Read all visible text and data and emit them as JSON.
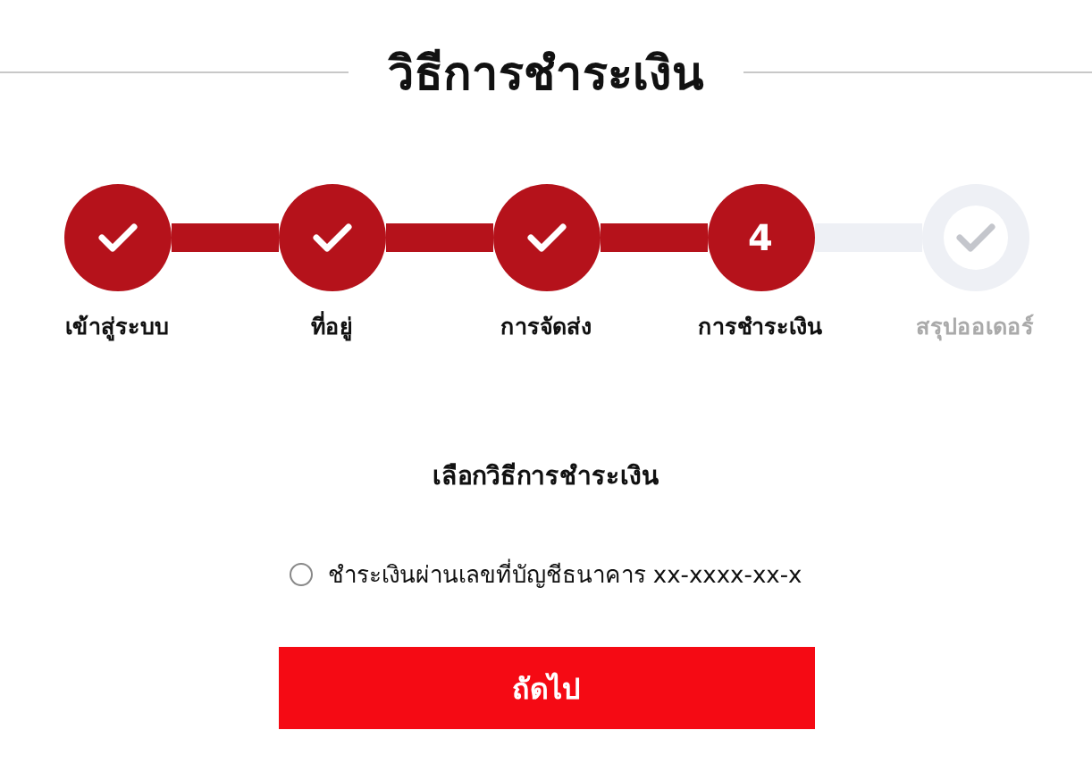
{
  "title": "วิธีการชำระเงิน",
  "steps": [
    {
      "label": "เข้าสู่ระบบ",
      "kind": "done"
    },
    {
      "label": "ที่อยู่",
      "kind": "done"
    },
    {
      "label": "การจัดส่ง",
      "kind": "done"
    },
    {
      "label": "การชำระเงิน",
      "kind": "current",
      "number": "4"
    },
    {
      "label": "สรุปออเดอร์",
      "kind": "pending"
    }
  ],
  "section_title": "เลือกวิธีการชำระเงิน",
  "payment_options": [
    {
      "label": "ชำระเงินผ่านเลขที่บัญชีธนาคาร xx-xxxx-xx-x",
      "selected": false
    }
  ],
  "next_button": "ถัดไป"
}
